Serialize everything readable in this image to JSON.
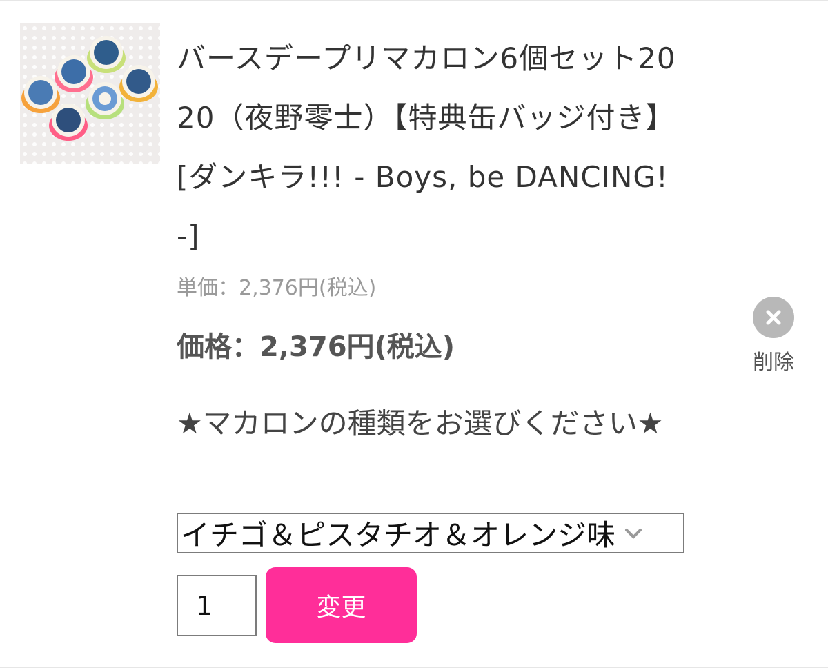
{
  "product": {
    "title": "バースデープリマカロン6個セット2020（夜野零士）【特典缶バッジ付き】[ダンキラ!!! - Boys, be DANCING! -]",
    "unit_price": "単価：2,376円(税込)",
    "price": "価格：2,376円(税込)"
  },
  "delete": {
    "label": "削除",
    "icon": "close-icon"
  },
  "option": {
    "label": "★マカロンの種類をお選びください★",
    "selected": "イチゴ＆ピスタチオ＆オレンジ味"
  },
  "quantity": {
    "value": "1"
  },
  "change_button": {
    "label": "変更",
    "color": "#ff2e99"
  }
}
